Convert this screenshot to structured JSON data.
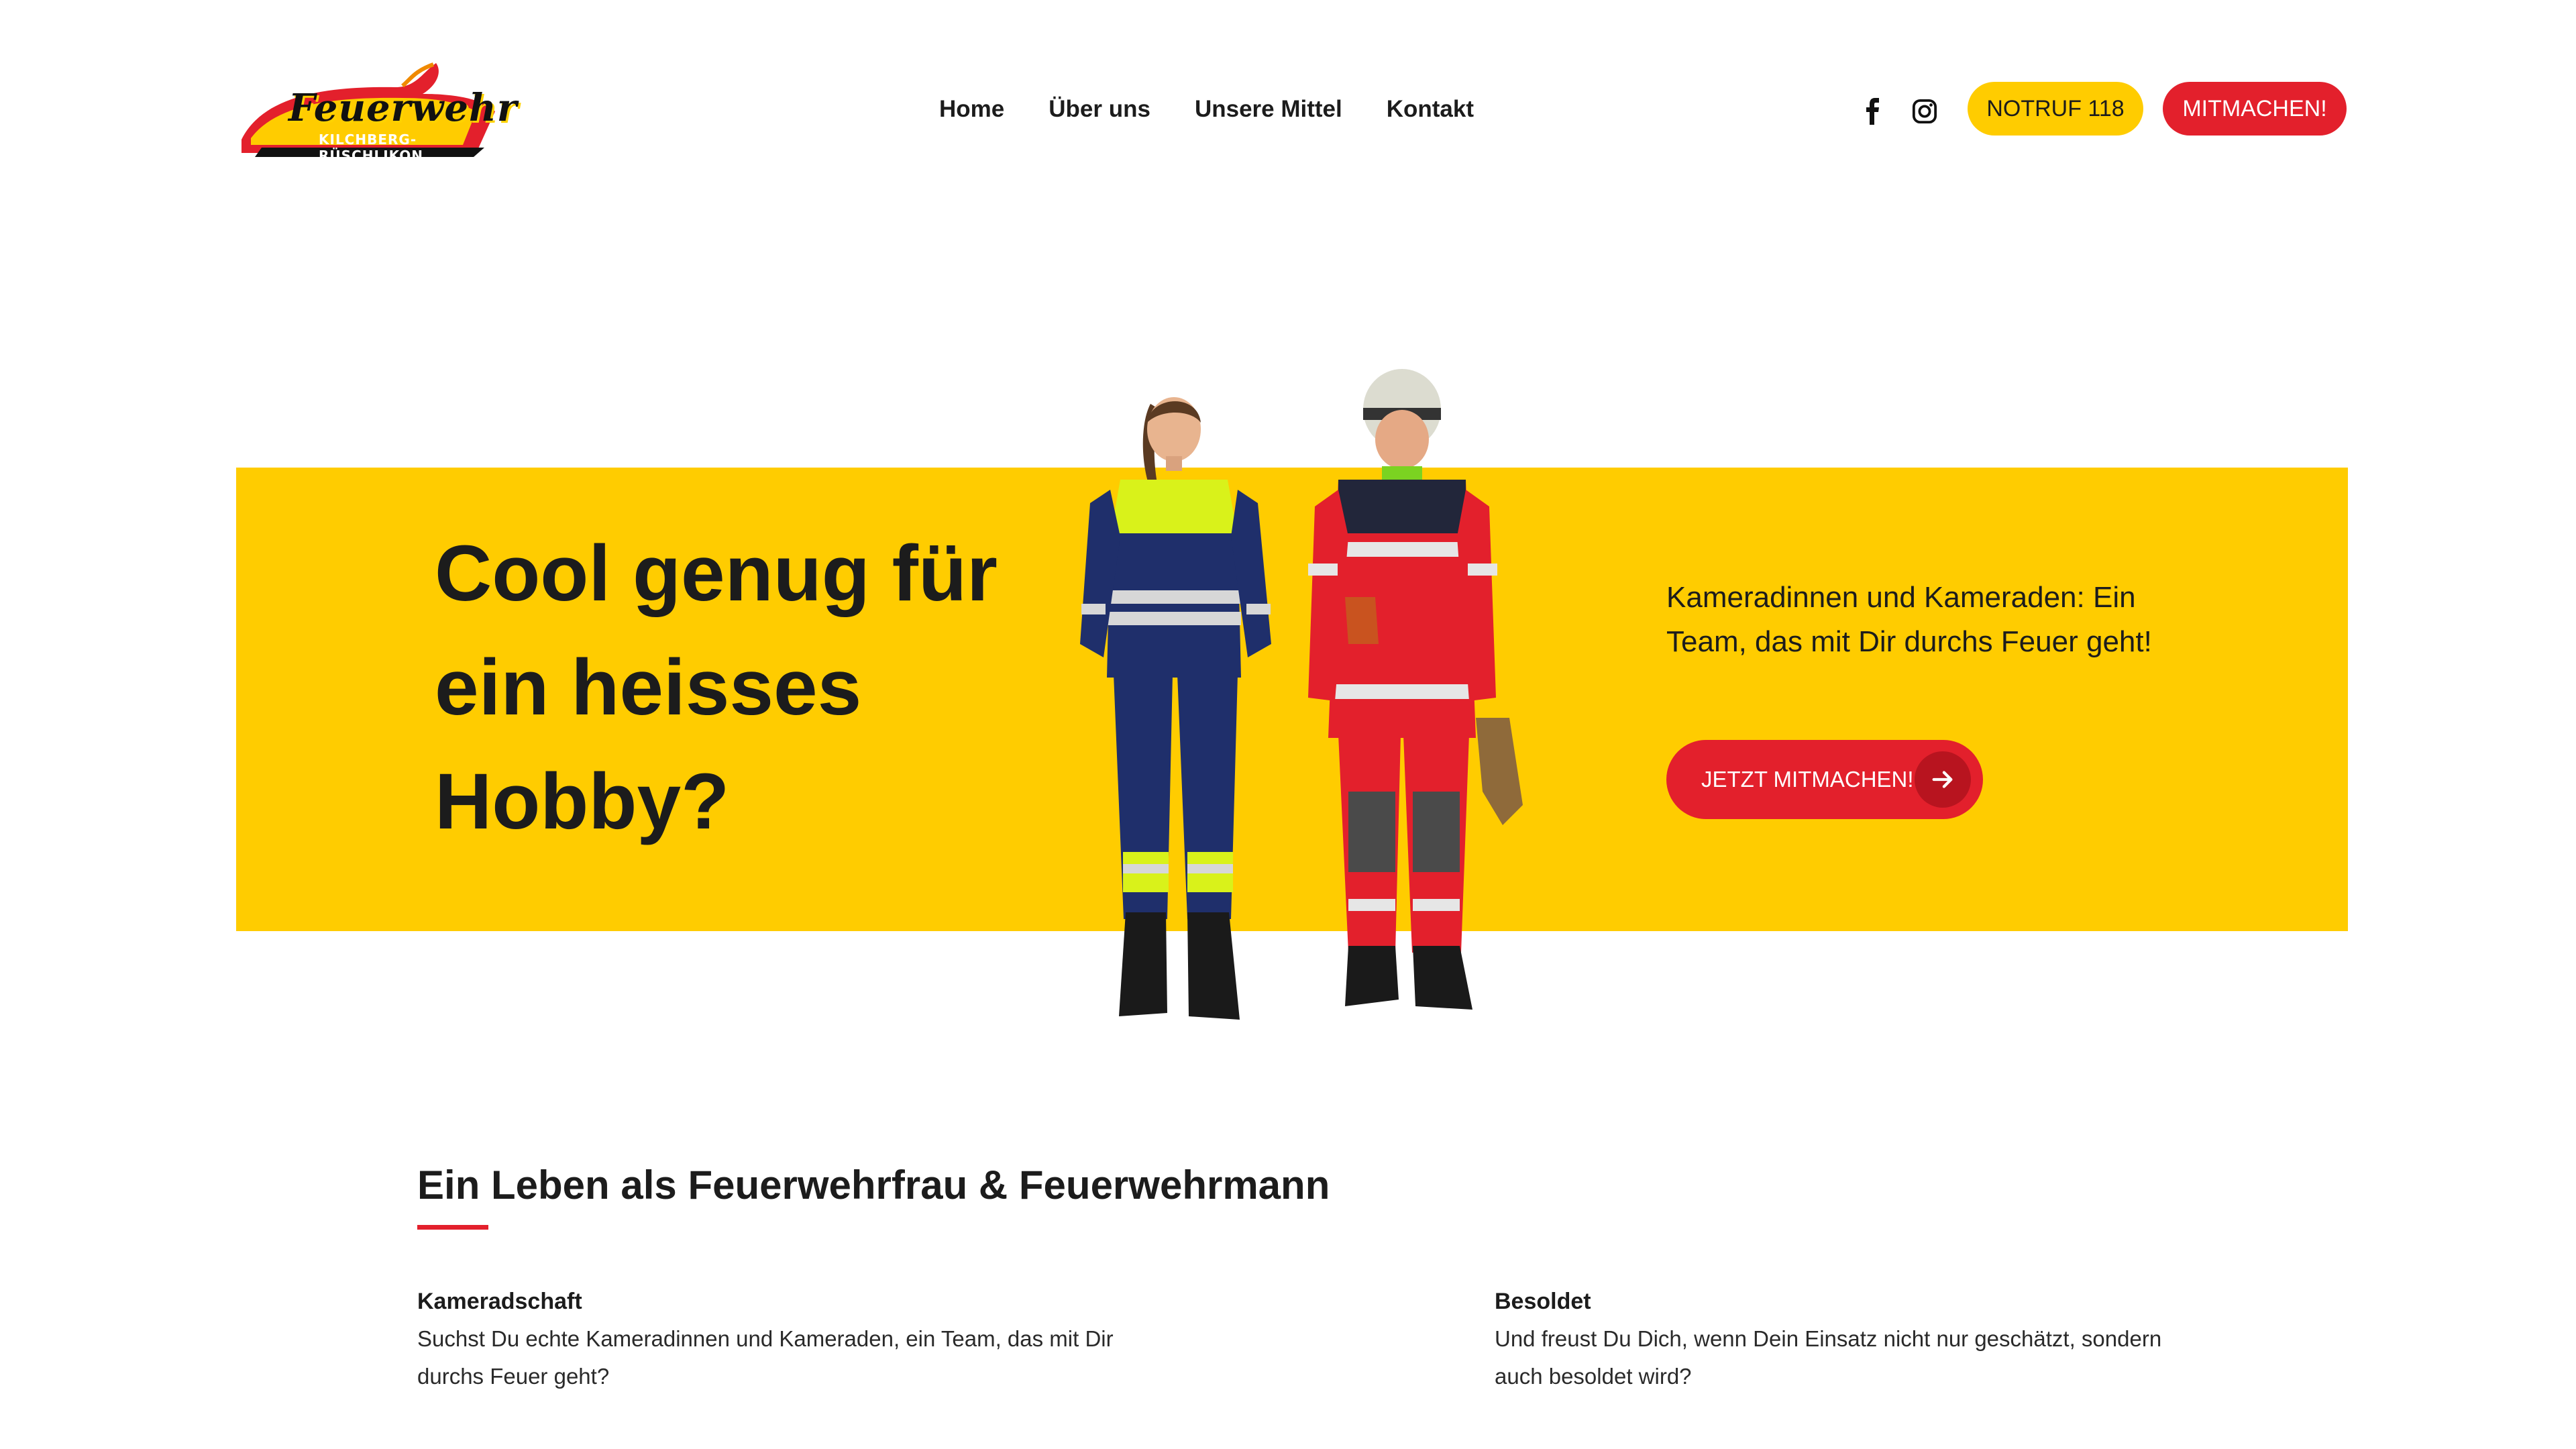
{
  "header": {
    "logo": {
      "wordmark": "Feuerwehr",
      "subtitle": "KILCHBERG-RÜSCHLIKON"
    },
    "nav": [
      {
        "label": "Home"
      },
      {
        "label": "Über uns"
      },
      {
        "label": "Unsere Mittel"
      },
      {
        "label": "Kontakt"
      }
    ],
    "social": [
      {
        "icon": "facebook-icon"
      },
      {
        "icon": "instagram-icon"
      }
    ],
    "notruf_label": "NOTRUF 118",
    "mitmachen_label": "MITMACHEN!"
  },
  "hero": {
    "title": "Cool genug für ein heisses Hobby?",
    "text": "Kameradinnen und Kameraden: Ein Team, das mit Dir durchs Feuer geht!",
    "button_label": "JETZT MITMACHEN!",
    "button_icon": "arrow-right-icon"
  },
  "section": {
    "title": "Ein Leben als Feuerwehrfrau & Feuerwehrmann",
    "features": [
      {
        "heading": "Kameradschaft",
        "text": "Suchst Du echte Kameradinnen und Kameraden, ein Team, das mit Dir durchs Feuer geht?"
      },
      {
        "heading": "Besoldet",
        "text": "Und freust Du Dich, wenn Dein Einsatz nicht nur geschätzt, sondern auch besoldet wird?"
      }
    ]
  },
  "colors": {
    "brand_yellow": "#ffcc00",
    "brand_red": "#e3202c",
    "text_dark": "#1c1c1c"
  }
}
